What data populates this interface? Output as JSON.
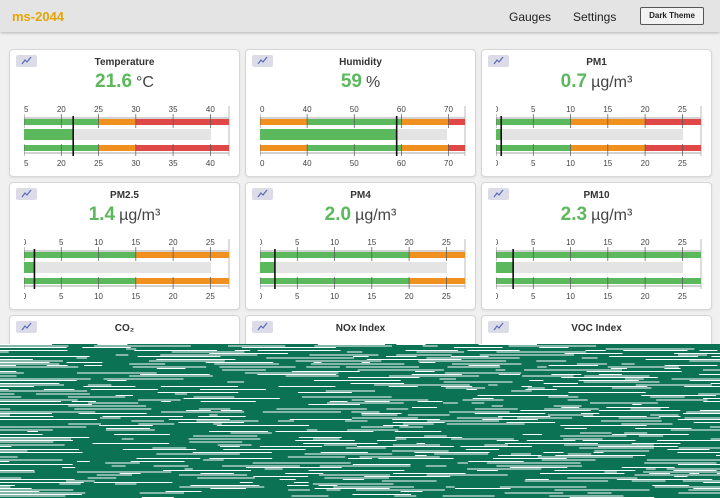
{
  "app": {
    "title": "ms-2044"
  },
  "nav": {
    "gauges": "Gauges",
    "settings": "Settings",
    "theme_button": "Dark Theme"
  },
  "colors": {
    "good": "#5cb85c",
    "warn": "#f0901e",
    "bad": "#e04848",
    "brand": "#e6a500"
  },
  "cards": [
    {
      "title": "Temperature",
      "value": "21.6",
      "unit": "°C",
      "value_color": "#5cb85c",
      "min": 15,
      "max": 42.5,
      "ticks": [
        "15",
        "20",
        "25",
        "30",
        "35",
        "40"
      ],
      "reading": 21.6,
      "zones": [
        {
          "from": 15,
          "to": 25,
          "c": "good"
        },
        {
          "from": 25,
          "to": 30,
          "c": "warn"
        },
        {
          "from": 30,
          "to": 42.5,
          "c": "bad"
        }
      ]
    },
    {
      "title": "Humidity",
      "value": "59",
      "unit": "%",
      "value_color": "#5cb85c",
      "min": 30,
      "max": 73.5,
      "ticks": [
        "30",
        "40",
        "50",
        "60",
        "70"
      ],
      "reading": 59,
      "zones": [
        {
          "from": 30,
          "to": 40,
          "c": "warn"
        },
        {
          "from": 40,
          "to": 60,
          "c": "good"
        },
        {
          "from": 60,
          "to": 70,
          "c": "warn"
        },
        {
          "from": 70,
          "to": 73.5,
          "c": "bad"
        }
      ]
    },
    {
      "title": "PM1",
      "value": "0.7",
      "unit": "µg/m³",
      "value_color": "#5cb85c",
      "min": 0,
      "max": 27.5,
      "ticks": [
        "0",
        "5",
        "10",
        "15",
        "20",
        "25"
      ],
      "reading": 0.7,
      "zones": [
        {
          "from": 0,
          "to": 10,
          "c": "good"
        },
        {
          "from": 10,
          "to": 20,
          "c": "warn"
        },
        {
          "from": 20,
          "to": 27.5,
          "c": "bad"
        }
      ]
    },
    {
      "title": "PM2.5",
      "value": "1.4",
      "unit": "µg/m³",
      "value_color": "#5cb85c",
      "min": 0,
      "max": 27.5,
      "ticks": [
        "0",
        "5",
        "10",
        "15",
        "20",
        "25"
      ],
      "reading": 1.4,
      "zones": [
        {
          "from": 0,
          "to": 15,
          "c": "good"
        },
        {
          "from": 15,
          "to": 27.5,
          "c": "warn"
        }
      ]
    },
    {
      "title": "PM4",
      "value": "2.0",
      "unit": "µg/m³",
      "value_color": "#5cb85c",
      "min": 0,
      "max": 27.5,
      "ticks": [
        "0",
        "5",
        "10",
        "15",
        "20",
        "25"
      ],
      "reading": 2.0,
      "zones": [
        {
          "from": 0,
          "to": 20,
          "c": "good"
        },
        {
          "from": 20,
          "to": 27.5,
          "c": "warn"
        }
      ]
    },
    {
      "title": "PM10",
      "value": "2.3",
      "unit": "µg/m³",
      "value_color": "#5cb85c",
      "min": 0,
      "max": 27.5,
      "ticks": [
        "0",
        "5",
        "10",
        "15",
        "20",
        "25"
      ],
      "reading": 2.3,
      "zones": [
        {
          "from": 0,
          "to": 27.5,
          "c": "good"
        }
      ]
    },
    {
      "title": "CO₂"
    },
    {
      "title": "NOx Index"
    },
    {
      "title": "VOC Index"
    }
  ]
}
